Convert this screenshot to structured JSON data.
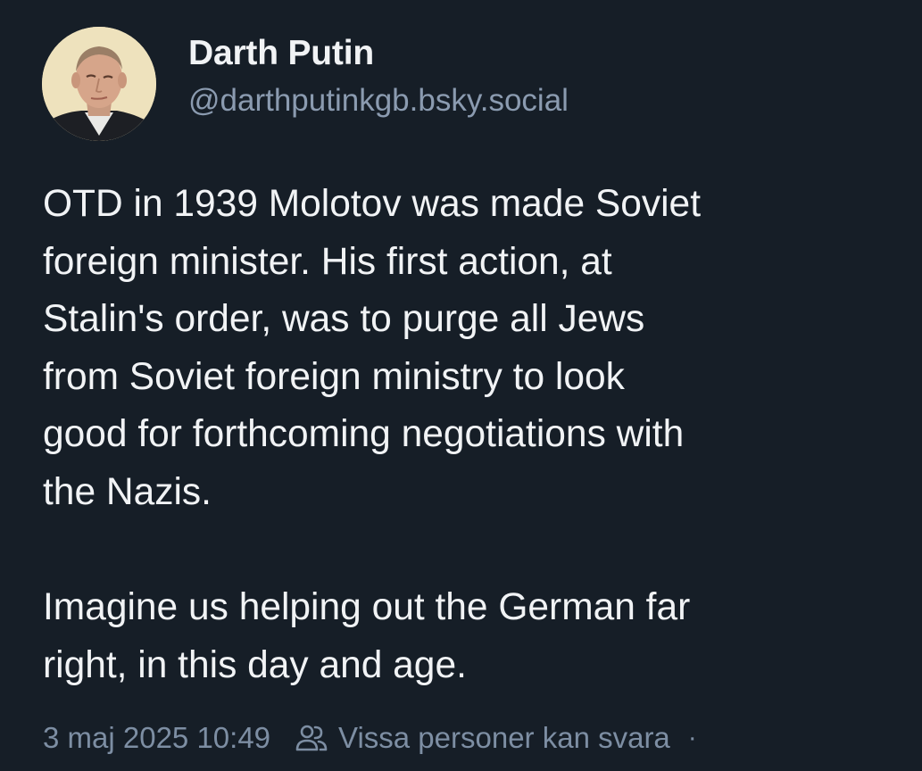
{
  "post": {
    "author": {
      "display_name": "Darth Putin",
      "handle": "@darthputinkgb.bsky.social"
    },
    "text": {
      "paragraph1": [
        "OTD in 1939 Molotov was made Soviet",
        "foreign minister. His first action, at",
        "Stalin's order, was to purge all Jews",
        "from Soviet foreign ministry to look",
        "good for forthcoming negotiations with",
        "the Nazis."
      ],
      "paragraph2": [
        "Imagine us helping out the German far",
        "right, in this day and age."
      ]
    },
    "meta": {
      "timestamp": "3 maj 2025 10:49",
      "reply_setting_icon": "people-icon",
      "reply_setting": "Vissa personer kan svara",
      "separator": "·"
    }
  },
  "colors": {
    "background": "#161e27",
    "text": "#f1f3f5",
    "muted": "#8b9bb0"
  }
}
